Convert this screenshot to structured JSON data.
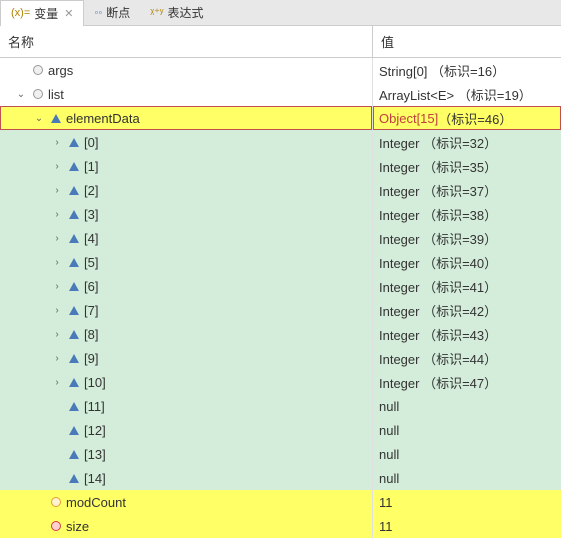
{
  "tabs": {
    "variables": "变量",
    "breakpoints": "断点",
    "expressions": "表达式"
  },
  "header": {
    "name": "名称",
    "value": "值"
  },
  "rows": [
    {
      "name": "args",
      "value": "String[0]  （标识=16）",
      "icon": "circle",
      "indent": 0,
      "arrow": "",
      "bg": "white"
    },
    {
      "name": "list",
      "value": "ArrayList<E>  （标识=19）",
      "icon": "circle",
      "indent": 0,
      "arrow": "down",
      "bg": "white"
    },
    {
      "name": "elementData",
      "value": "Object[15]",
      "valsuffix": "（标识=46）",
      "icon": "triangle",
      "indent": 1,
      "arrow": "down",
      "bg": "yellow",
      "selected": true,
      "valred": true
    },
    {
      "name": "[0]",
      "value": "Integer  （标识=32）",
      "icon": "triangle",
      "indent": 2,
      "arrow": "right",
      "bg": "green"
    },
    {
      "name": "[1]",
      "value": "Integer  （标识=35）",
      "icon": "triangle",
      "indent": 2,
      "arrow": "right",
      "bg": "green"
    },
    {
      "name": "[2]",
      "value": "Integer  （标识=37）",
      "icon": "triangle",
      "indent": 2,
      "arrow": "right",
      "bg": "green"
    },
    {
      "name": "[3]",
      "value": "Integer  （标识=38）",
      "icon": "triangle",
      "indent": 2,
      "arrow": "right",
      "bg": "green"
    },
    {
      "name": "[4]",
      "value": "Integer  （标识=39）",
      "icon": "triangle",
      "indent": 2,
      "arrow": "right",
      "bg": "green"
    },
    {
      "name": "[5]",
      "value": "Integer  （标识=40）",
      "icon": "triangle",
      "indent": 2,
      "arrow": "right",
      "bg": "green"
    },
    {
      "name": "[6]",
      "value": "Integer  （标识=41）",
      "icon": "triangle",
      "indent": 2,
      "arrow": "right",
      "bg": "green"
    },
    {
      "name": "[7]",
      "value": "Integer  （标识=42）",
      "icon": "triangle",
      "indent": 2,
      "arrow": "right",
      "bg": "green"
    },
    {
      "name": "[8]",
      "value": "Integer  （标识=43）",
      "icon": "triangle",
      "indent": 2,
      "arrow": "right",
      "bg": "green"
    },
    {
      "name": "[9]",
      "value": "Integer  （标识=44）",
      "icon": "triangle",
      "indent": 2,
      "arrow": "right",
      "bg": "green"
    },
    {
      "name": "[10]",
      "value": "Integer  （标识=47）",
      "icon": "triangle",
      "indent": 2,
      "arrow": "right",
      "bg": "green"
    },
    {
      "name": "[11]",
      "value": "null",
      "icon": "triangle",
      "indent": 2,
      "arrow": "",
      "bg": "green"
    },
    {
      "name": "[12]",
      "value": "null",
      "icon": "triangle",
      "indent": 2,
      "arrow": "",
      "bg": "green"
    },
    {
      "name": "[13]",
      "value": "null",
      "icon": "triangle",
      "indent": 2,
      "arrow": "",
      "bg": "green"
    },
    {
      "name": "[14]",
      "value": "null",
      "icon": "triangle",
      "indent": 2,
      "arrow": "",
      "bg": "green"
    },
    {
      "name": "modCount",
      "value": "11",
      "icon": "circle-orange",
      "indent": 1,
      "arrow": "",
      "bg": "yellow"
    },
    {
      "name": "size",
      "value": "11",
      "icon": "circle-red",
      "indent": 1,
      "arrow": "",
      "bg": "yellow"
    }
  ]
}
